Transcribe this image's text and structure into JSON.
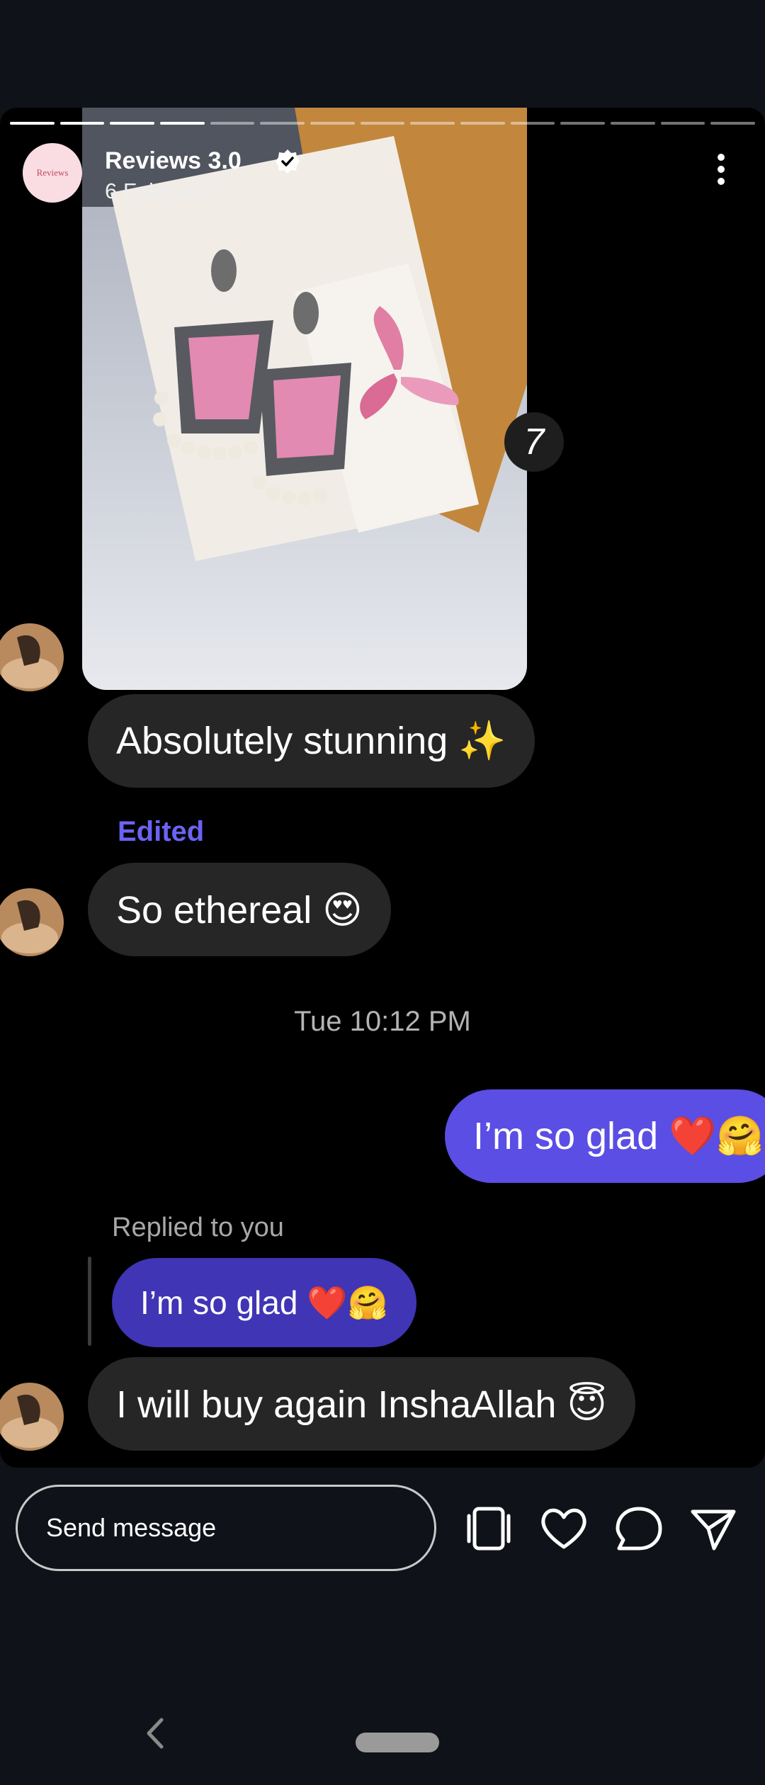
{
  "story": {
    "account_name": "Reviews 3.0",
    "account_logo_text": "Reviews",
    "date": "6 February",
    "progress_segments": 15,
    "progress_done": 4,
    "overlay_badge": "7"
  },
  "messages": {
    "m1": "Absolutely stunning ✨",
    "edited_label": "Edited",
    "m2": "So ethereal 😍",
    "timestamp": "Tue 10:12 PM",
    "mine": "I’m so glad ❤️🤗",
    "replied_label": "Replied to you",
    "quoted": "I’m so glad ❤️🤗",
    "m3": "I will buy again InshaAllah 😇"
  },
  "composer": {
    "placeholder": "Send message"
  },
  "icons": [
    "more-icon",
    "verified-icon",
    "stack-icon",
    "heart-icon",
    "comment-icon",
    "send-icon",
    "back-icon"
  ]
}
